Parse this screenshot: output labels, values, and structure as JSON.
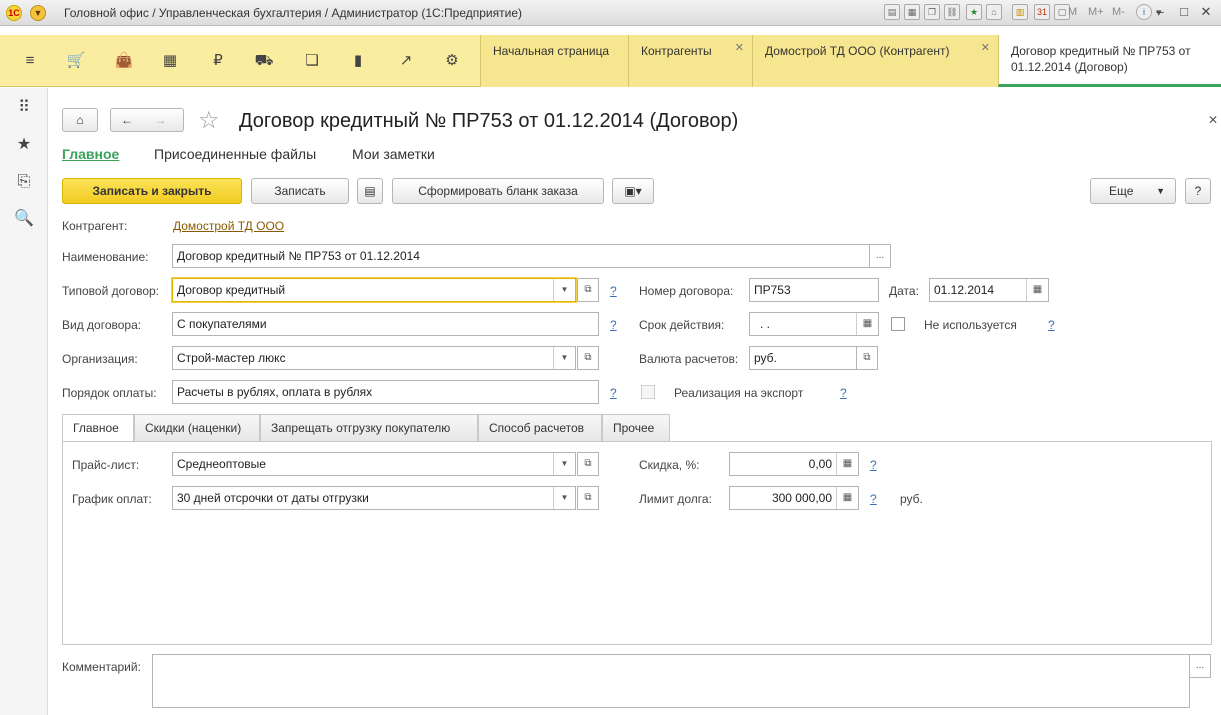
{
  "window": {
    "title": "Головной офис / Управленческая бухгалтерия / Администратор  (1С:Предприятие)",
    "logo_text": "1C",
    "toolbar_texts": [
      "M",
      "M+",
      "M-"
    ]
  },
  "open_tabs": [
    {
      "label": "Начальная страница",
      "closable": false,
      "active": false
    },
    {
      "label": "Контрагенты",
      "closable": true,
      "active": false
    },
    {
      "label": "Домострой ТД ООО (Контрагент)",
      "closable": true,
      "active": false
    },
    {
      "label": "Договор кредитный № ПР753 от 01.12.2014 (Договор)",
      "closable": false,
      "active": true
    }
  ],
  "form": {
    "title": "Договор кредитный № ПР753 от 01.12.2014 (Договор)",
    "nav": [
      "Главное",
      "Присоединенные файлы",
      "Мои заметки"
    ],
    "commands": {
      "save_close": "Записать и закрыть",
      "save": "Записать",
      "order_form": "Сформировать бланк заказа",
      "more": "Еще",
      "help": "?"
    },
    "counterparty": {
      "label": "Контрагент:",
      "value": "Домострой ТД ООО"
    },
    "name": {
      "label": "Наименование:",
      "value": "Договор кредитный № ПР753 от 01.12.2014"
    },
    "template": {
      "label": "Типовой договор:",
      "value": "Договор кредитный"
    },
    "kind": {
      "label": "Вид договора:",
      "value": "С покупателями"
    },
    "organization": {
      "label": "Организация:",
      "value": "Строй-мастер люкс"
    },
    "payment_order": {
      "label": "Порядок оплаты:",
      "value": "Расчеты в рублях, оплата в рублях"
    },
    "number": {
      "label": "Номер договора:",
      "value": "ПР753"
    },
    "date": {
      "label": "Дата:",
      "value": "01.12.2014"
    },
    "validity": {
      "label": "Срок действия:",
      "value": " .  ."
    },
    "not_used": {
      "label": "Не используется"
    },
    "currency": {
      "label": "Валюта расчетов:",
      "value": "руб."
    },
    "export": {
      "label": "Реализация на экспорт"
    },
    "help_mark": "?",
    "tabs": [
      "Главное",
      "Скидки (наценки)",
      "Запрещать отгрузку покупателю",
      "Способ расчетов",
      "Прочее"
    ],
    "price_list": {
      "label": "Прайс-лист:",
      "value": "Среднеоптовые"
    },
    "payment_schedule": {
      "label": "График оплат:",
      "value": "30 дней отсрочки от даты отгрузки"
    },
    "discount": {
      "label": "Скидка, %:",
      "value": "0,00"
    },
    "debt_limit": {
      "label": "Лимит долга:",
      "value": "300 000,00",
      "unit": "руб."
    },
    "comment": {
      "label": "Комментарий:",
      "value": ""
    }
  }
}
